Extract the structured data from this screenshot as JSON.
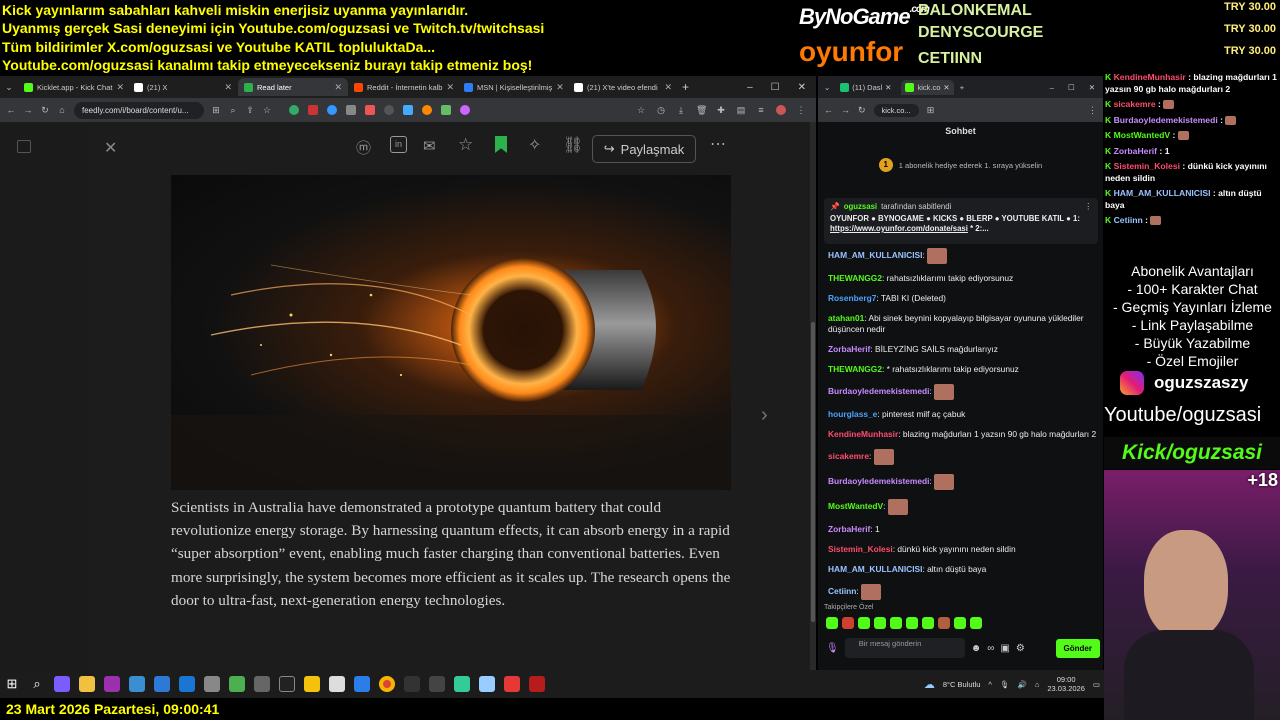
{
  "overlay": {
    "ticker_lines": [
      "Kick yayınlarım sabahları kahveli miskin enerjisiz uyanma yayınlarıdır.",
      "Uyanmış gerçek Sasi deneyimi için Youtube.com/oguzsasi ve Twitch.tv/twitchsasi",
      "Tüm bildirimler X.com/oguzsasi ve Youtube KATIL topluluktaDa...",
      "Youtube.com/oguzsasi kanalımı takip etmeyecekseniz burayı takip etmeniz boş!"
    ],
    "sponsor_logo_1": "ByNoGame",
    "sponsor_logo_1_suffix": ".com",
    "sponsor_logo_2": "oyunfor",
    "donor_names": [
      "BALONKEMAL",
      "DENYSCOURGE",
      "CETIINN"
    ],
    "donation_amounts": [
      "TRY 30.00",
      "TRY 30.00",
      "TRY 30.00"
    ],
    "date_footer": "23 Mart 2026 Pazartesi, 09:00:41"
  },
  "browser": {
    "tabs": [
      {
        "label": "Kicklet.app - Kick Chat",
        "color": "#53fc18"
      },
      {
        "label": "(21) X",
        "color": "#ffffff"
      },
      {
        "label": "Read later",
        "color": "#2bb24c",
        "active": true
      },
      {
        "label": "Reddit - İnternetin kalb",
        "color": "#ff4500"
      },
      {
        "label": "MSN | Kişiselleştirilmiş",
        "color": "#2d7df6"
      },
      {
        "label": "(21) X'te video efendi",
        "color": "#ffffff"
      }
    ],
    "new_tab": "+",
    "url": "feedly.com/i/board/content/u...",
    "share_button": "Paylaşmak",
    "more": "⋯",
    "article_text": "Scientists in Australia have demonstrated a prototype quantum battery that could revolutionize energy storage. By harnessing quantum effects, it can absorb energy in a rapid “super absorption” event, enabling much faster charging than conventional batteries. Even more surprisingly, the system becomes more efficient as it scales up. The research opens the door to ultra-fast, next-generation energy technologies."
  },
  "chat": {
    "tabs": [
      "(11) Dasl",
      "kick.co"
    ],
    "url": "kick.co...",
    "header": "Sohbet",
    "gift_rank": "1",
    "gift_text": "1 abonelik hediye ederek 1. sıraya yükselin",
    "pinned_by": "oguzsasi",
    "pinned_label": "tarafından sabitlendi",
    "pinned_text": "OYUNFOR ● BYNOGAME ● KICKS ● BLERP ● YOUTUBE KATIL ● 1:",
    "pinned_link": "https://www.oyunfor.com/donate/sasi",
    "pinned_tail": "* 2:...",
    "messages": [
      {
        "user": "HAM_AM_KULLANICISI",
        "color": "#9bc3ff",
        "text": "",
        "emote": true
      },
      {
        "user": "THEWANGG2",
        "color": "#53fc18",
        "text": "rahatsızlıklarımı takip ediyorsunuz",
        "emote": false
      },
      {
        "user": "Rosenberg7",
        "color": "#4aa3ff",
        "text": "TABI KI (Deleted)",
        "emote": false
      },
      {
        "user": "atahan01",
        "color": "#53fc18",
        "text": "Abi sinek beynini kopyalayıp bilgisayar oyununa yüklediler düşüncen nedir",
        "emote": false
      },
      {
        "user": "ZorbaHerif",
        "color": "#c88bff",
        "text": "BİLEYZİNG SAİLS mağdurlarıyız",
        "emote": false
      },
      {
        "user": "THEWANGG2",
        "color": "#53fc18",
        "text": "* rahatsızlıklarımı takip ediyorsunuz",
        "emote": false
      },
      {
        "user": "Burdaoyledemekistemedi",
        "color": "#c88bff",
        "text": "",
        "emote": true
      },
      {
        "user": "hourglass_e",
        "color": "#4aa3ff",
        "text": "pinterest milf aç çabuk",
        "emote": false
      },
      {
        "user": "KendineMunhasir",
        "color": "#ff4d6d",
        "text": "blazing mağdurları 1 yazsın 90 gb halo mağdurları 2",
        "emote": false
      },
      {
        "user": "sicakemre",
        "color": "#ff4d6d",
        "text": "",
        "emote": true
      },
      {
        "user": "Burdaoyledemekistemedi",
        "color": "#c88bff",
        "text": "",
        "emote": true
      },
      {
        "user": "MostWantedV",
        "color": "#53fc18",
        "text": "",
        "emote": true
      },
      {
        "user": "ZorbaHerif",
        "color": "#c88bff",
        "text": "1",
        "emote": false
      },
      {
        "user": "Sistemin_Kolesi",
        "color": "#ff4d6d",
        "text": "dünkü kick yayınını neden sildin",
        "emote": false
      },
      {
        "user": "HAM_AM_KULLANICISI",
        "color": "#9bc3ff",
        "text": "altın düştü baya",
        "emote": false
      },
      {
        "user": "Cetiinn",
        "color": "#9bc3ff",
        "text": "",
        "emote": true
      }
    ],
    "followers_label": "Takipçilere Özel",
    "input_placeholder": "Bir mesaj gönderin",
    "send_button": "Gönder"
  },
  "overlay_chat": [
    {
      "user": "KendineMunhasir",
      "color": "#ff4d6d",
      "text": "blazing mağdurları 1 yazsın 90 gb halo mağdurları 2"
    },
    {
      "user": "sicakemre",
      "color": "#ff4d6d",
      "text": ""
    },
    {
      "user": "Burdaoyledemekistemedi",
      "color": "#c88bff",
      "text": ""
    },
    {
      "user": "MostWantedV",
      "color": "#53fc18",
      "text": ""
    },
    {
      "user": "ZorbaHerif",
      "color": "#c88bff",
      "text": "1"
    },
    {
      "user": "Sistemin_Kolesi",
      "color": "#ff4d6d",
      "text": "dünkü kick yayınını neden sildin"
    },
    {
      "user": "HAM_AM_KULLANICISI",
      "color": "#9bc3ff",
      "text": "altın düştü baya"
    },
    {
      "user": "Cetiinn",
      "color": "#9bc3ff",
      "text": ""
    }
  ],
  "perks": {
    "title": "Abonelik Avantajları",
    "items": [
      "- 100+ Karakter Chat",
      "- Geçmiş Yayınları İzleme",
      "- Link Paylaşabilme",
      "- Büyük Yazabilme",
      "- Özel Emojiler"
    ]
  },
  "instagram_handle": "oguzszaszy",
  "youtube_line": "Youtube/oguzsasi",
  "kick_line": "Kick/oguzsasi",
  "age_badge": "+18",
  "taskbar": {
    "weather": "8°C Bulutlu",
    "time": "09:00",
    "date": "23.03.2026"
  }
}
